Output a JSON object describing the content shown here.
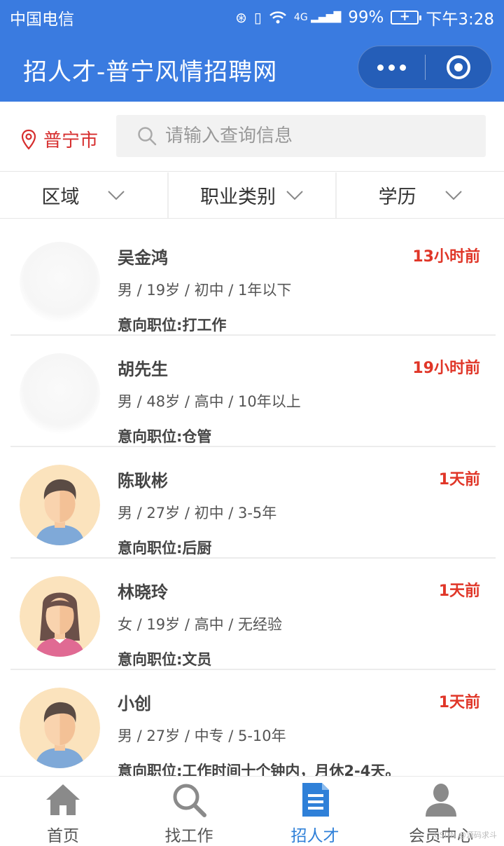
{
  "status_bar": {
    "carrier": "中国电信",
    "battery": "99%",
    "time": "下午3:28",
    "network": "4G"
  },
  "header": {
    "title": "招人才-普宁风情招聘网"
  },
  "search": {
    "city": "普宁市",
    "placeholder": "请输入查询信息"
  },
  "filters": [
    {
      "label": "区域"
    },
    {
      "label": "职业类别"
    },
    {
      "label": "学历"
    }
  ],
  "candidates": [
    {
      "name": "吴金鸿",
      "time": "13小时前",
      "meta": "男 / 19岁 / 初中 / 1年以下",
      "job_label": "意向职位:",
      "job_value": "打工作",
      "avatar": "blank-avatar"
    },
    {
      "name": "胡先生",
      "time": "19小时前",
      "meta": "男 / 48岁 / 高中 / 10年以上",
      "job_label": "意向职位:",
      "job_value": "仓管",
      "avatar": "blank-avatar"
    },
    {
      "name": "陈耿彬",
      "time": "1天前",
      "meta": "男 / 27岁 / 初中 / 3-5年",
      "job_label": "意向职位:",
      "job_value": "后厨",
      "avatar": "male-avatar-icon"
    },
    {
      "name": "林晓玲",
      "time": "1天前",
      "meta": "女 / 19岁 / 高中 / 无经验",
      "job_label": "意向职位:",
      "job_value": "文员",
      "avatar": "female-avatar-icon"
    },
    {
      "name": "小创",
      "time": "1天前",
      "meta": "男 / 27岁 / 中专 / 5-10年",
      "job_label": "意向职位:",
      "job_value": "工作时间十个钟内，月休2-4天。",
      "avatar": "male-avatar-icon"
    }
  ],
  "tabs": [
    {
      "label": "首页",
      "icon": "home-icon"
    },
    {
      "label": "找工作",
      "icon": "search-icon"
    },
    {
      "label": "招人才",
      "icon": "document-icon"
    },
    {
      "label": "会员中心",
      "icon": "user-icon"
    }
  ],
  "watermark": "CSDN @源码求斗",
  "colors": {
    "header_bg": "#3a7be0",
    "accent_red": "#e03628",
    "active_tab": "#2f80d8",
    "inactive_tab": "#8a8a8a"
  }
}
